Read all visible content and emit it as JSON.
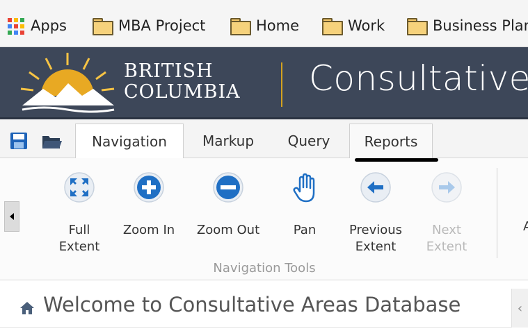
{
  "bookmarks": {
    "items": [
      {
        "label": "Apps",
        "icon": "apps-grid-icon"
      },
      {
        "label": "MBA Project",
        "icon": "folder-icon"
      },
      {
        "label": "Home",
        "icon": "folder-icon"
      },
      {
        "label": "Work",
        "icon": "folder-icon"
      },
      {
        "label": "Business Plan",
        "icon": "folder-icon"
      }
    ]
  },
  "banner": {
    "org_line1": "BRITISH",
    "org_line2": "COLUMBIA",
    "app_title": "Consultative Areas Database",
    "colors": {
      "background": "#3d4759",
      "sun": "#e8a923",
      "mountain": "#ffffff",
      "divider": "#d4a21f"
    }
  },
  "tabs": [
    {
      "label": "Navigation",
      "active": true
    },
    {
      "label": "Markup",
      "active": false
    },
    {
      "label": "Query",
      "active": false
    },
    {
      "label": "Reports",
      "active": false
    }
  ],
  "toolbar_icons": [
    "save-icon",
    "open-folder-icon"
  ],
  "ribbon": {
    "group_label": "Navigation Tools",
    "cut_off_next_label": "A",
    "tools": [
      {
        "line1": "Full",
        "line2": "Extent",
        "icon": "full-extent-icon",
        "enabled": true
      },
      {
        "line1": "Zoom In",
        "line2": "",
        "icon": "zoom-in-icon",
        "enabled": true
      },
      {
        "line1": "Zoom Out",
        "line2": "",
        "icon": "zoom-out-icon",
        "enabled": true
      },
      {
        "line1": "Pan",
        "line2": "",
        "icon": "pan-hand-icon",
        "enabled": true
      },
      {
        "line1": "Previous",
        "line2": "Extent",
        "icon": "previous-extent-icon",
        "enabled": true
      },
      {
        "line1": "Next",
        "line2": "Extent",
        "icon": "next-extent-icon",
        "enabled": false
      }
    ],
    "accent_color": "#1f6fc4"
  },
  "welcome": {
    "text": "Welcome to Consultative Areas Database",
    "icon": "home-icon",
    "collapse_glyph": "‹"
  }
}
